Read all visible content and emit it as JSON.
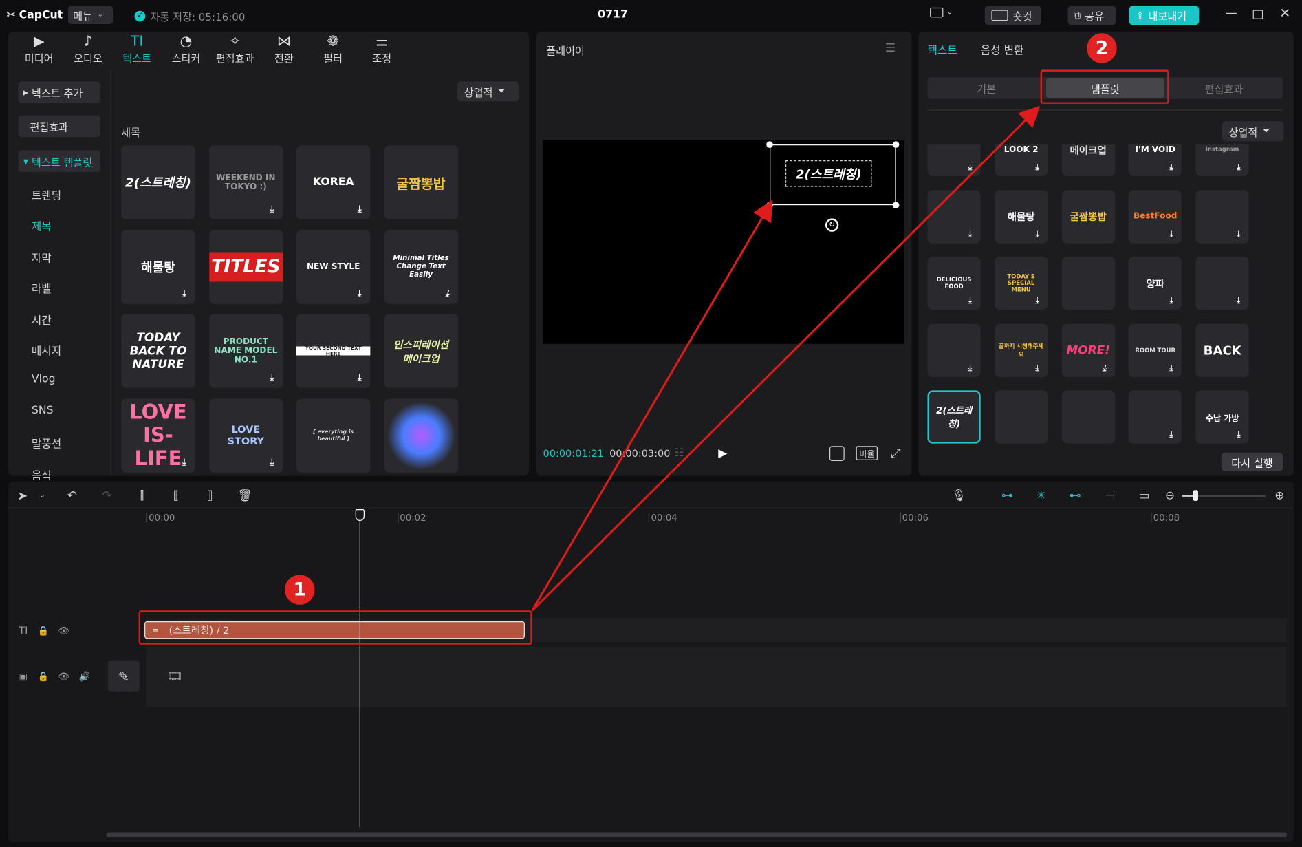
{
  "app": {
    "name": "CapCut",
    "menu_label": "메뉴",
    "autosave": "자동 저장: 05:16:00",
    "project_title": "0717"
  },
  "titlebar": {
    "shortcut_label": "숏컷",
    "share_label": "공유",
    "export_label": "내보내기"
  },
  "toolbar": [
    {
      "label": "미디어",
      "icon": "media-icon",
      "glyph": "▶"
    },
    {
      "label": "오디오",
      "icon": "audio-icon",
      "glyph": "♪"
    },
    {
      "label": "텍스트",
      "icon": "text-icon",
      "glyph": "TI"
    },
    {
      "label": "스티커",
      "icon": "sticker-icon",
      "glyph": "◔"
    },
    {
      "label": "편집효과",
      "icon": "effects-icon",
      "glyph": "✧"
    },
    {
      "label": "전환",
      "icon": "transition-icon",
      "glyph": "⋈"
    },
    {
      "label": "필터",
      "icon": "filter-icon",
      "glyph": "❁"
    },
    {
      "label": "조정",
      "icon": "adjust-icon",
      "glyph": "⚌"
    }
  ],
  "sidebar": {
    "add_text": "텍스트 추가",
    "effects": "편집효과",
    "text_template": "텍스트 템플릿",
    "items": [
      "트렌딩",
      "제목",
      "자막",
      "라벨",
      "시간",
      "메시지",
      "Vlog",
      "SNS",
      "말풍선",
      "음식"
    ]
  },
  "library": {
    "filter_label": "상업적",
    "section_title": "제목",
    "templates": [
      {
        "text": "2(스트레칭)"
      },
      {
        "text": "WEEKEND IN TOKYO :)"
      },
      {
        "text": "KOREA"
      },
      {
        "text": "굴짬뽕밥"
      },
      {
        "text": "해물탕"
      },
      {
        "text": "TITLES"
      },
      {
        "text": "NEW STYLE"
      },
      {
        "text": "Minimal Titles Change Text Easily"
      },
      {
        "text": "TODAY BACK TO NATURE"
      },
      {
        "text": "PRODUCT NAME MODEL NO.1"
      },
      {
        "text": "YOUR SECOND TEXT HERE"
      },
      {
        "text": "인스피레이션 메이크업"
      },
      {
        "text": "LOVE IS-LIFE"
      },
      {
        "text": "LOVE STORY"
      },
      {
        "text": "[ everyting is beautiful ]"
      },
      {
        "text": ""
      }
    ]
  },
  "player": {
    "title": "플레이어",
    "overlay_text": "2(스트레칭)",
    "current_time": "00:00:01:21",
    "total_time": "00:00:03:00",
    "ratio_label": "비율"
  },
  "right_panel": {
    "tabs": [
      "텍스트",
      "음성 변환"
    ],
    "subtabs": [
      "기본",
      "템플릿",
      "편집효과"
    ],
    "filter_label": "상업적",
    "rerun_label": "다시 실행",
    "templates": [
      "",
      "LOOK 2",
      "메이크업",
      "I'M VOID",
      "instagram",
      "",
      "해물탕",
      "굴짬뽕밥",
      "BestFood",
      "",
      "DELICIOUS FOOD",
      "TODAY'S SPECIAL MENU",
      "",
      "양파",
      "",
      "",
      "끝까지 시청해주세요",
      "MORE!",
      "ROOM TOUR",
      "BACK",
      "2(스트레칭)",
      "",
      "",
      "",
      "수납 가방"
    ]
  },
  "timeline": {
    "ticks": [
      "00:00",
      "00:02",
      "00:04",
      "00:06",
      "00:08"
    ],
    "clip_label": "(스트레칭) / 2"
  },
  "annotations": {
    "badge1": "1",
    "badge2": "2"
  }
}
